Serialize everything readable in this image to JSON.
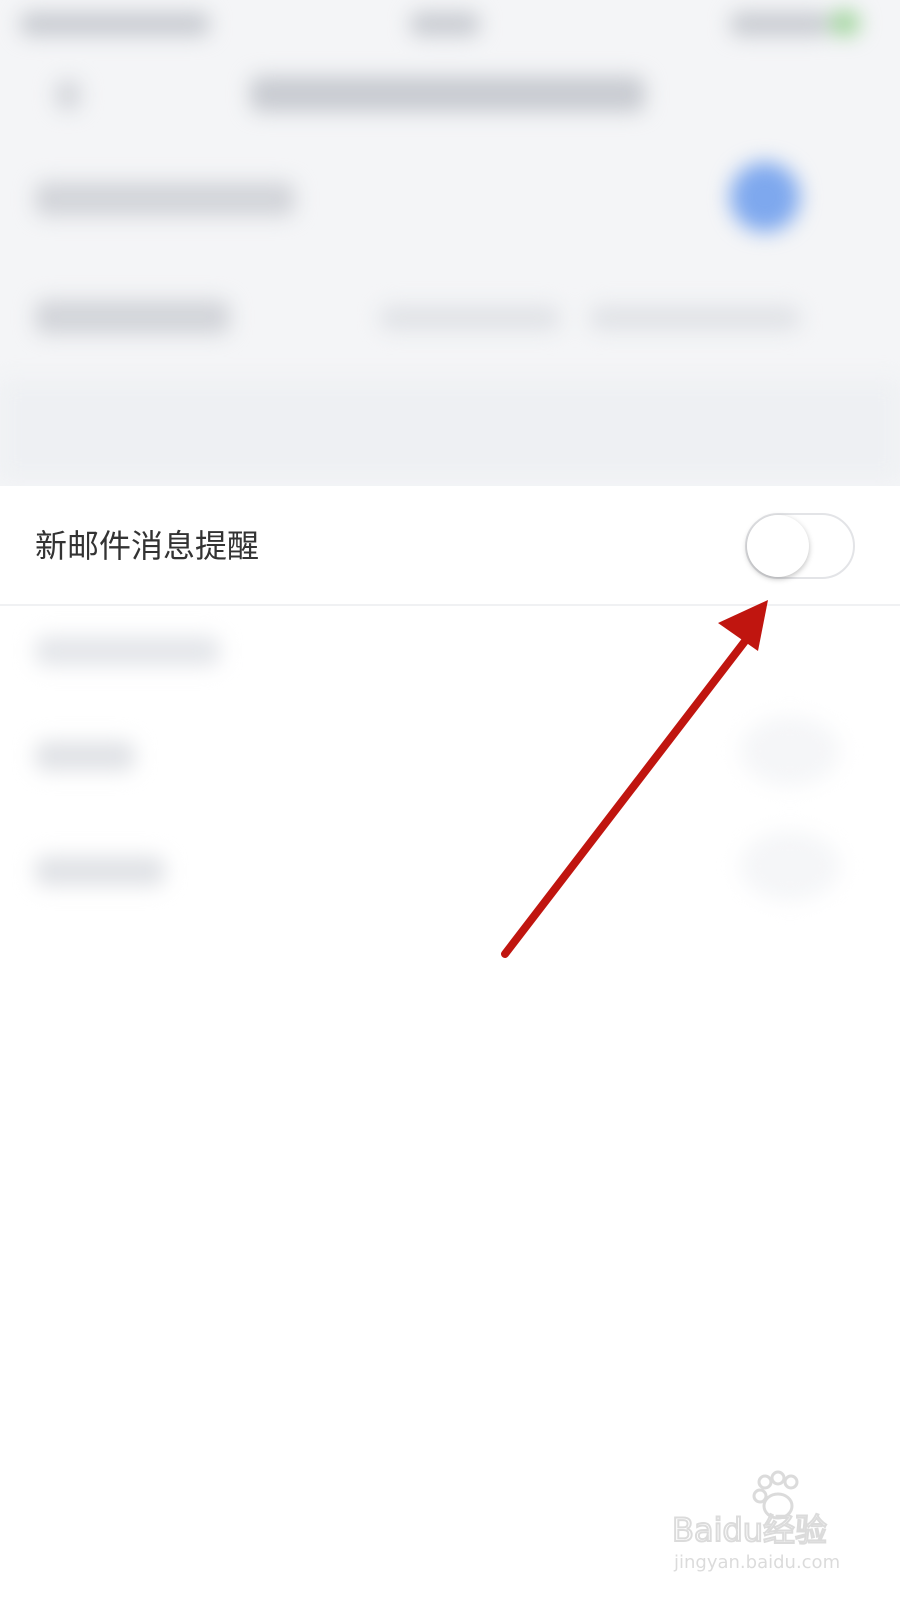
{
  "setting": {
    "label": "新邮件消息提醒",
    "toggle_on": false
  },
  "annotation": {
    "arrow_color": "#c0150f"
  },
  "watermark": {
    "brand": "Baidu经验",
    "url": "jingyan.baidu.com"
  },
  "colors": {
    "background_blur": "#f4f5f7",
    "row_background": "#ffffff",
    "label_text": "#333333",
    "blurred_accent": "#5b8ff0"
  }
}
